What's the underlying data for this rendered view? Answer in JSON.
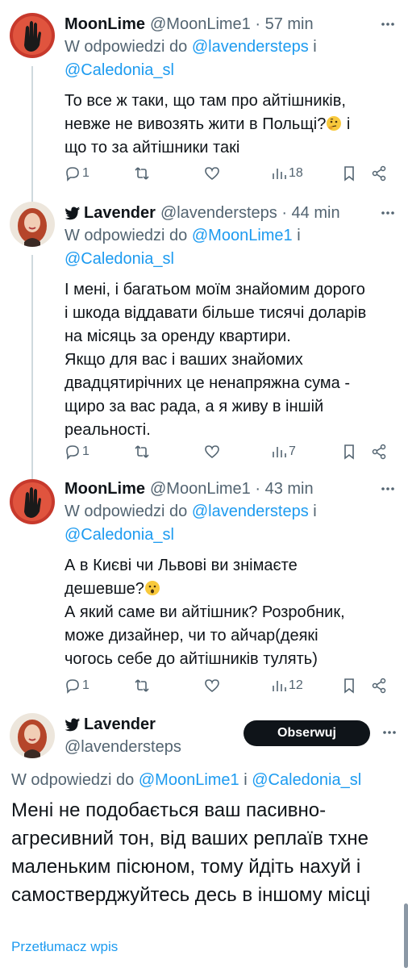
{
  "tweets": [
    {
      "author": "MoonLime",
      "handle_time": "@MoonLime1 · 57 min",
      "reply_prefix": "W odpowiedzi do ",
      "reply_user1": "@lavendersteps",
      "reply_join": " i",
      "reply_user2": "@Caledonia_sl",
      "text_lines": [
        "То все ж таки, що там про айтішників,",
        "невже не вивозять жити в Польщі?",
        " і",
        "що то за айтішники такі"
      ],
      "emoji": "thinking-face",
      "replies": "1",
      "views": "18"
    },
    {
      "author": "Lavender",
      "handle_time": "@lavendersteps · 44 min",
      "reply_prefix": "W odpowiedzi do ",
      "reply_user1": "@MoonLime1",
      "reply_join": " i",
      "reply_user2": "@Caledonia_sl",
      "text_lines": [
        "І мені, і багатьом моїм знайомим дорого",
        "і шкода віддавати більше тисячі доларів",
        "на місяць за оренду квартири.",
        "Якщо для вас і ваших знайомих",
        "двадцятирічних це ненапряжна сума -",
        "щиро за вас рада, а я живу в іншій",
        "реальності."
      ],
      "replies": "1",
      "views": "7"
    },
    {
      "author": "MoonLime",
      "handle_time": "@MoonLime1 · 43 min",
      "reply_prefix": "W odpowiedzi do ",
      "reply_user1": "@lavendersteps",
      "reply_join": " i",
      "reply_user2": "@Caledonia_sl",
      "text_lines": [
        "А в Києві чи Львові ви знімаєте",
        "дешевше?",
        "А який саме ви айтішник? Розробник,",
        "може дизайнер, чи то айчар(деякі",
        "чогось себе до айтішників тулять)"
      ],
      "emoji": "surprised-face",
      "replies": "1",
      "views": "12"
    }
  ],
  "focal": {
    "author": "Lavender",
    "handle": "@lavendersteps",
    "follow_label": "Obserwuj",
    "reply_prefix": "W odpowiedzi do ",
    "reply_user1": "@MoonLime1",
    "reply_join": " i ",
    "reply_user2": "@Caledonia_sl",
    "text": "Мені не подобається ваш пасивно-агресивний тон, від ваших реплаїв тхне маленьким пісюном, тому йдіть нахуй і самостверджуйтесь десь в іншому місці",
    "translate_label": "Przetłumacz wpis"
  },
  "colors": {
    "link": "#1d9bf0",
    "secondary": "#536471",
    "primary_text": "#0f1419",
    "follow_button": "#0f1419"
  }
}
